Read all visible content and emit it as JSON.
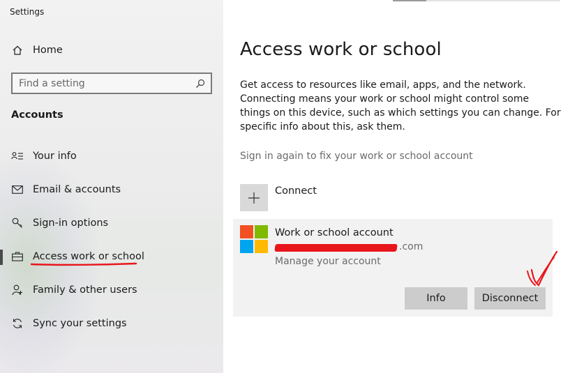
{
  "window": {
    "title": "Settings"
  },
  "sidebar": {
    "home_label": "Home",
    "search_placeholder": "Find a setting",
    "section_heading": "Accounts",
    "items": [
      {
        "label": "Your info",
        "icon": "person-card-icon"
      },
      {
        "label": "Email & accounts",
        "icon": "mail-icon"
      },
      {
        "label": "Sign-in options",
        "icon": "key-icon"
      },
      {
        "label": "Access work or school",
        "icon": "briefcase-icon",
        "selected": true
      },
      {
        "label": "Family & other users",
        "icon": "person-add-icon"
      },
      {
        "label": "Sync your settings",
        "icon": "sync-icon"
      }
    ]
  },
  "main": {
    "title": "Access work or school",
    "description": "Get access to resources like email, apps, and the network. Connecting means your work or school might control some things on this device, such as which settings you can change. For specific info about this, ask them.",
    "signin_link": "Sign in again to fix your work or school account",
    "connect_label": "Connect",
    "account": {
      "title": "Work or school account",
      "email_suffix": ".com",
      "manage_link": "Manage your account",
      "info_button": "Info",
      "disconnect_button": "Disconnect"
    }
  },
  "colors": {
    "ms_red": "#f25022",
    "ms_green": "#7fba00",
    "ms_blue": "#00a4ef",
    "ms_yellow": "#ffb900",
    "annotation_red": "#e8161b"
  }
}
